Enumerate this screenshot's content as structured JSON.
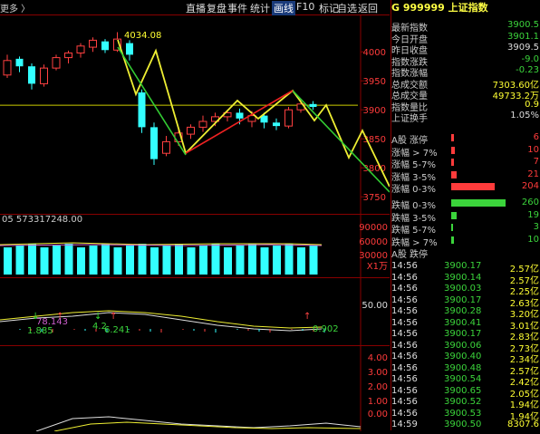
{
  "topbar": {
    "more_label": "更多 〉",
    "tabs": [
      "直播",
      "复盘",
      "事件",
      "统计",
      "画线",
      "F10",
      "标记",
      "自选",
      "返回"
    ],
    "active_tab": "画线"
  },
  "price_chart": {
    "high_label": "4034.08",
    "yticks": [
      "4000",
      "3950",
      "3900",
      "3850",
      "3800",
      "3750"
    ],
    "yvals": [
      4000,
      3950,
      3900,
      3850,
      3800,
      3750
    ],
    "ylim": [
      3730,
      4055
    ],
    "candles": [
      {
        "o": 3960,
        "c": 3985,
        "h": 3995,
        "l": 3955,
        "up": true
      },
      {
        "o": 3988,
        "c": 3975,
        "h": 3992,
        "l": 3965,
        "up": false
      },
      {
        "o": 3975,
        "c": 3945,
        "h": 3980,
        "l": 3935,
        "up": false
      },
      {
        "o": 3945,
        "c": 3972,
        "h": 3978,
        "l": 3940,
        "up": true
      },
      {
        "o": 3972,
        "c": 3990,
        "h": 3995,
        "l": 3968,
        "up": true
      },
      {
        "o": 3990,
        "c": 3998,
        "h": 4002,
        "l": 3980,
        "up": true
      },
      {
        "o": 3998,
        "c": 4010,
        "h": 4015,
        "l": 3990,
        "up": true
      },
      {
        "o": 4008,
        "c": 4020,
        "h": 4025,
        "l": 4000,
        "up": true
      },
      {
        "o": 4018,
        "c": 4003,
        "h": 4022,
        "l": 3998,
        "up": false
      },
      {
        "o": 4003,
        "c": 4022,
        "h": 4034,
        "l": 4000,
        "up": true
      },
      {
        "o": 4015,
        "c": 3995,
        "h": 4020,
        "l": 3985,
        "up": false
      },
      {
        "o": 3930,
        "c": 3870,
        "h": 3935,
        "l": 3860,
        "up": false
      },
      {
        "o": 3870,
        "c": 3815,
        "h": 3878,
        "l": 3805,
        "up": false
      },
      {
        "o": 3825,
        "c": 3845,
        "h": 3855,
        "l": 3820,
        "up": true
      },
      {
        "o": 3845,
        "c": 3860,
        "h": 3868,
        "l": 3838,
        "up": true
      },
      {
        "o": 3858,
        "c": 3870,
        "h": 3875,
        "l": 3850,
        "up": true
      },
      {
        "o": 3870,
        "c": 3880,
        "h": 3890,
        "l": 3862,
        "up": true
      },
      {
        "o": 3880,
        "c": 3888,
        "h": 3895,
        "l": 3872,
        "up": true
      },
      {
        "o": 3888,
        "c": 3895,
        "h": 3900,
        "l": 3880,
        "up": true
      },
      {
        "o": 3895,
        "c": 3885,
        "h": 3902,
        "l": 3875,
        "up": false
      },
      {
        "o": 3880,
        "c": 3890,
        "h": 3898,
        "l": 3870,
        "up": true
      },
      {
        "o": 3890,
        "c": 3878,
        "h": 3895,
        "l": 3868,
        "up": false
      },
      {
        "o": 3878,
        "c": 3872,
        "h": 3885,
        "l": 3865,
        "up": false
      },
      {
        "o": 3872,
        "c": 3900,
        "h": 3905,
        "l": 3868,
        "up": true
      },
      {
        "o": 3900,
        "c": 3910,
        "h": 3918,
        "l": 3895,
        "up": true
      },
      {
        "o": 3910,
        "c": 3905,
        "h": 3915,
        "l": 3900,
        "up": false
      }
    ]
  },
  "volume_chart": {
    "label": "05  573317248.00",
    "yticks": [
      "90000",
      "60000",
      "30000",
      "X1万"
    ],
    "bars": [
      6,
      6,
      5,
      6,
      6,
      6,
      6,
      6,
      6,
      6,
      6,
      5,
      6,
      6,
      6,
      6,
      6,
      6,
      6,
      6,
      6,
      6,
      6,
      6,
      6,
      6,
      6,
      6,
      6,
      6,
      6,
      5
    ]
  },
  "indicator_chart": {
    "yticks": [
      "50.00"
    ],
    "labels": [
      {
        "text": "78.143",
        "color": "#d060d0"
      },
      {
        "text": "1.885",
        "color": "#3bd43b"
      },
      {
        "text": "4.2",
        "color": "#3bd43b"
      },
      {
        "text": "6.241",
        "color": "#3bd43b"
      },
      {
        "text": "0.902",
        "color": "#3bd43b"
      }
    ]
  },
  "osc_chart": {
    "yticks": [
      "4.00",
      "3.00",
      "2.00",
      "1.00",
      "0.00"
    ]
  },
  "right_panel": {
    "code": "999999",
    "name": "上证指数",
    "prefix": "G",
    "stats": [
      {
        "label": "最新指数",
        "value": "3900.5",
        "color": "#3bd43b"
      },
      {
        "label": "今日开盘",
        "value": "3901.1",
        "color": "#3bd43b"
      },
      {
        "label": "昨日收盘",
        "value": "3909.5",
        "color": "#ddd"
      },
      {
        "label": "指数涨跌",
        "value": "-9.0",
        "color": "#3bd43b"
      },
      {
        "label": "指数涨幅",
        "value": "-0.23",
        "color": "#3bd43b"
      },
      {
        "label": "总成交额",
        "value": "7303.60亿",
        "color": "#ff3"
      },
      {
        "label": "总成交量",
        "value": "49733.2万",
        "color": "#ff3"
      },
      {
        "label": "指数量比",
        "value": "0.9",
        "color": "#ff3"
      },
      {
        "label": "上证换手",
        "value": "1.05%",
        "color": "#ddd"
      }
    ],
    "dist": [
      {
        "label": "A股 涨停",
        "value": "6",
        "color": "#ff3b3b",
        "bar": 3
      },
      {
        "label": "涨幅 > 7%",
        "value": "10",
        "color": "#ff3b3b",
        "bar": 4
      },
      {
        "label": "涨幅 5-7%",
        "value": "7",
        "color": "#ff3b3b",
        "bar": 3
      },
      {
        "label": "涨幅 3-5%",
        "value": "21",
        "color": "#ff3b3b",
        "bar": 6
      },
      {
        "label": "涨幅 0-3%",
        "value": "204",
        "color": "#ff3b3b",
        "bar": 48
      },
      {
        "label": "跌幅 0-3%",
        "value": "260",
        "color": "#3bd43b",
        "bar": 60
      },
      {
        "label": "跌幅 3-5%",
        "value": "19",
        "color": "#3bd43b",
        "bar": 6
      },
      {
        "label": "跌幅 5-7%",
        "value": "3",
        "color": "#3bd43b",
        "bar": 2
      },
      {
        "label": "跌幅 > 7%",
        "value": "10",
        "color": "#3bd43b",
        "bar": 3
      },
      {
        "label": "A股 跌停",
        "value": "",
        "color": "#3bd43b",
        "bar": 0
      }
    ],
    "ticks": [
      {
        "t": "14:56",
        "p": "3900.17",
        "c": "2.57亿",
        "pc": "#3bd43b"
      },
      {
        "t": "14:56",
        "p": "3900.14",
        "c": "2.57亿",
        "pc": "#3bd43b"
      },
      {
        "t": "14:56",
        "p": "3900.03",
        "c": "2.25亿",
        "pc": "#3bd43b"
      },
      {
        "t": "14:56",
        "p": "3900.17",
        "c": "2.63亿",
        "pc": "#3bd43b"
      },
      {
        "t": "14:56",
        "p": "3900.28",
        "c": "3.20亿",
        "pc": "#3bd43b"
      },
      {
        "t": "14:56",
        "p": "3900.41",
        "c": "3.01亿",
        "pc": "#3bd43b"
      },
      {
        "t": "14:56",
        "p": "3900.17",
        "c": "2.83亿",
        "pc": "#3bd43b"
      },
      {
        "t": "14:56",
        "p": "3900.06",
        "c": "2.73亿",
        "pc": "#3bd43b"
      },
      {
        "t": "14:56",
        "p": "3900.40",
        "c": "2.34亿",
        "pc": "#3bd43b"
      },
      {
        "t": "14:56",
        "p": "3900.48",
        "c": "2.57亿",
        "pc": "#3bd43b"
      },
      {
        "t": "14:56",
        "p": "3900.54",
        "c": "2.42亿",
        "pc": "#3bd43b"
      },
      {
        "t": "14:56",
        "p": "3900.65",
        "c": "2.05亿",
        "pc": "#3bd43b"
      },
      {
        "t": "14:56",
        "p": "3900.52",
        "c": "1.94亿",
        "pc": "#3bd43b"
      },
      {
        "t": "14:56",
        "p": "3900.53",
        "c": "1.94亿",
        "pc": "#3bd43b"
      },
      {
        "t": "14:59",
        "p": "3900.50",
        "c": "8307.6",
        "pc": "#3bd43b"
      }
    ]
  }
}
